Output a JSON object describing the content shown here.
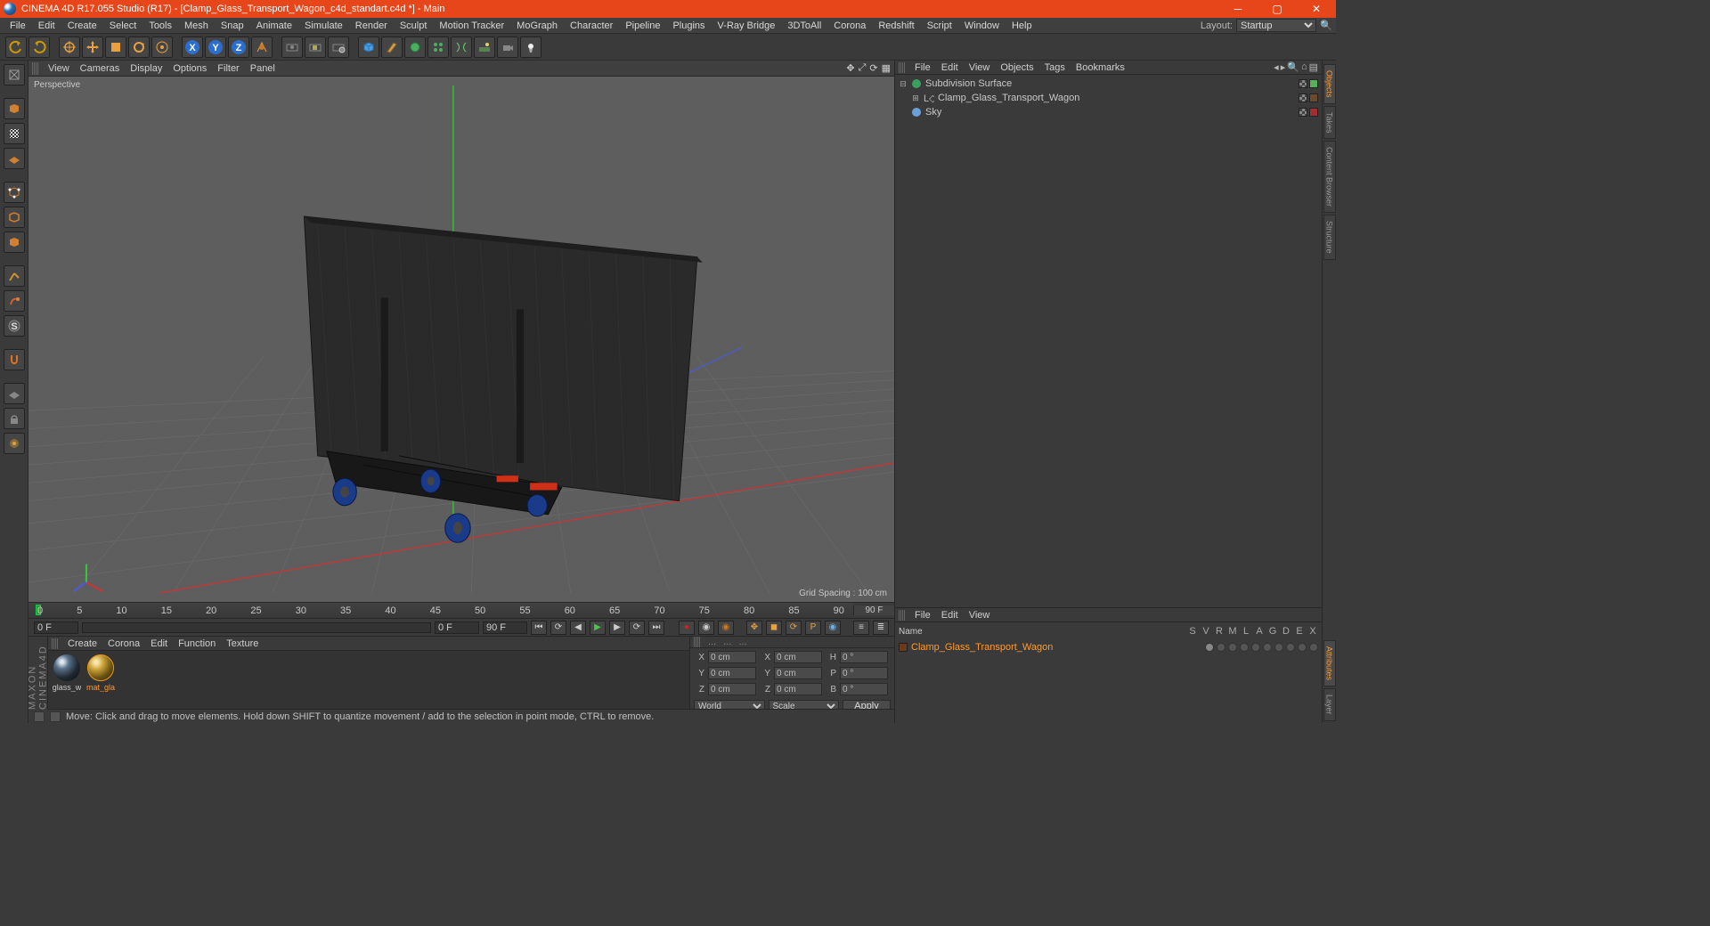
{
  "title": "CINEMA 4D R17.055 Studio (R17) - [Clamp_Glass_Transport_Wagon_c4d_standart.c4d *] - Main",
  "menus": [
    "File",
    "Edit",
    "Create",
    "Select",
    "Tools",
    "Mesh",
    "Snap",
    "Animate",
    "Simulate",
    "Render",
    "Sculpt",
    "Motion Tracker",
    "MoGraph",
    "Character",
    "Pipeline",
    "Plugins",
    "V-Ray Bridge",
    "3DToAll",
    "Corona",
    "Redshift",
    "Script",
    "Window",
    "Help"
  ],
  "layout_label": "Layout:",
  "layout_value": "Startup",
  "viewport_menu": [
    "View",
    "Cameras",
    "Display",
    "Options",
    "Filter",
    "Panel"
  ],
  "viewport_label": "Perspective",
  "grid_spacing": "Grid Spacing : 100 cm",
  "timeline": {
    "start": 0,
    "end": 90,
    "step": 5,
    "end_label": "90 F",
    "zero_label": "0 F",
    "range_label": "0 F"
  },
  "materials_menu": [
    "Create",
    "Corona",
    "Edit",
    "Function",
    "Texture"
  ],
  "materials": [
    {
      "name": "glass_w",
      "sel": false,
      "ball": "gl"
    },
    {
      "name": "mat_gla",
      "sel": true,
      "ball": "tx"
    }
  ],
  "coord": {
    "header": [
      "...",
      "...",
      "..."
    ],
    "rows": [
      {
        "a": "X",
        "av": "0 cm",
        "b": "X",
        "bv": "0 cm",
        "c": "H",
        "cv": "0 °"
      },
      {
        "a": "Y",
        "av": "0 cm",
        "b": "Y",
        "bv": "0 cm",
        "c": "P",
        "cv": "0 °"
      },
      {
        "a": "Z",
        "av": "0 cm",
        "b": "Z",
        "bv": "0 cm",
        "c": "B",
        "cv": "0 °"
      }
    ],
    "mode1": "World",
    "mode2": "Scale",
    "apply": "Apply"
  },
  "status": "Move: Click and drag to move elements. Hold down SHIFT to quantize movement / add to the selection in point mode, CTRL to remove.",
  "obj_menu": [
    "File",
    "Edit",
    "View",
    "Objects",
    "Tags",
    "Bookmarks"
  ],
  "attr_menu": [
    "File",
    "Edit",
    "View"
  ],
  "objects": [
    {
      "indent": 0,
      "exp": "minus",
      "icon": "subdiv",
      "name": "Subdivision Surface",
      "tags": [
        "checker",
        "vis"
      ]
    },
    {
      "indent": 1,
      "exp": "plus",
      "icon": "null",
      "name": "Clamp_Glass_Transport_Wagon",
      "tags": [
        "checker",
        "mat"
      ]
    },
    {
      "indent": 0,
      "exp": "",
      "icon": "sky",
      "name": "Sky",
      "tags": [
        "checker",
        "red"
      ]
    }
  ],
  "attr": {
    "name_label": "Name",
    "cols": [
      "S",
      "V",
      "R",
      "M",
      "L",
      "A",
      "G",
      "D",
      "E",
      "X"
    ],
    "row_name": "Clamp_Glass_Transport_Wagon"
  },
  "right_tabs": [
    "Objects",
    "Takes",
    "Content Browser",
    "Structure"
  ],
  "right_tabs2": [
    "Attributes",
    "Layer"
  ],
  "maxon": "MAXON CINEMA4D"
}
